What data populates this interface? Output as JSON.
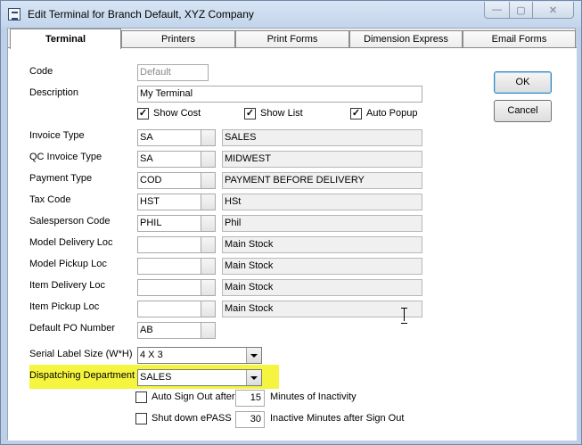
{
  "window": {
    "title": "Edit Terminal  for Branch Default, XYZ Company",
    "controls": {
      "minimize": "—",
      "maximize": "▢",
      "close": "✕"
    }
  },
  "tabs": [
    {
      "label": "Terminal",
      "active": true
    },
    {
      "label": "Printers",
      "active": false
    },
    {
      "label": "Print Forms",
      "active": false
    },
    {
      "label": "Dimension Express",
      "active": false
    },
    {
      "label": "Email Forms",
      "active": false
    }
  ],
  "form": {
    "code": {
      "label": "Code",
      "value": "Default"
    },
    "description": {
      "label": "Description",
      "value": "My Terminal"
    },
    "checks": {
      "show_cost": {
        "label": "Show Cost",
        "checked": true,
        "mark": "✓"
      },
      "show_list": {
        "label": "Show List",
        "checked": true,
        "mark": "✓"
      },
      "auto_popup": {
        "label": "Auto Popup",
        "checked": true,
        "mark": "✓"
      }
    },
    "lookups": [
      {
        "label": "Invoice Type",
        "code": "SA",
        "description": "SALES"
      },
      {
        "label": "QC Invoice Type",
        "code": "SA",
        "description": "MIDWEST"
      },
      {
        "label": "Payment Type",
        "code": "COD",
        "description": "PAYMENT BEFORE DELIVERY"
      },
      {
        "label": "Tax Code",
        "code": "HST",
        "description": "HSt"
      },
      {
        "label": "Salesperson Code",
        "code": "PHIL",
        "description": "Phil"
      },
      {
        "label": "Model Delivery Loc",
        "code": "",
        "description": "Main Stock"
      },
      {
        "label": "Model Pickup Loc",
        "code": "",
        "description": "Main Stock"
      },
      {
        "label": "Item Delivery Loc",
        "code": "",
        "description": "Main Stock"
      },
      {
        "label": "Item Pickup Loc",
        "code": "",
        "description": "Main Stock"
      }
    ],
    "default_po": {
      "label": "Default PO Number",
      "value": "AB"
    },
    "serial_label": {
      "label": "Serial Label Size  (W*H)",
      "value": "4 X 3",
      "highlight_color": "#f5f53f"
    },
    "dispatching": {
      "label": "Dispatching Department",
      "value": "SALES"
    },
    "auto_sign_out": {
      "label": "Auto Sign Out after",
      "value": "15",
      "suffix": "Minutes of Inactivity",
      "checked": false
    },
    "shut_down": {
      "label": "Shut down ePASS",
      "value": "30",
      "suffix": "Inactive Minutes after Sign Out",
      "checked": false
    }
  },
  "buttons": {
    "ok": "OK",
    "cancel": "Cancel"
  }
}
